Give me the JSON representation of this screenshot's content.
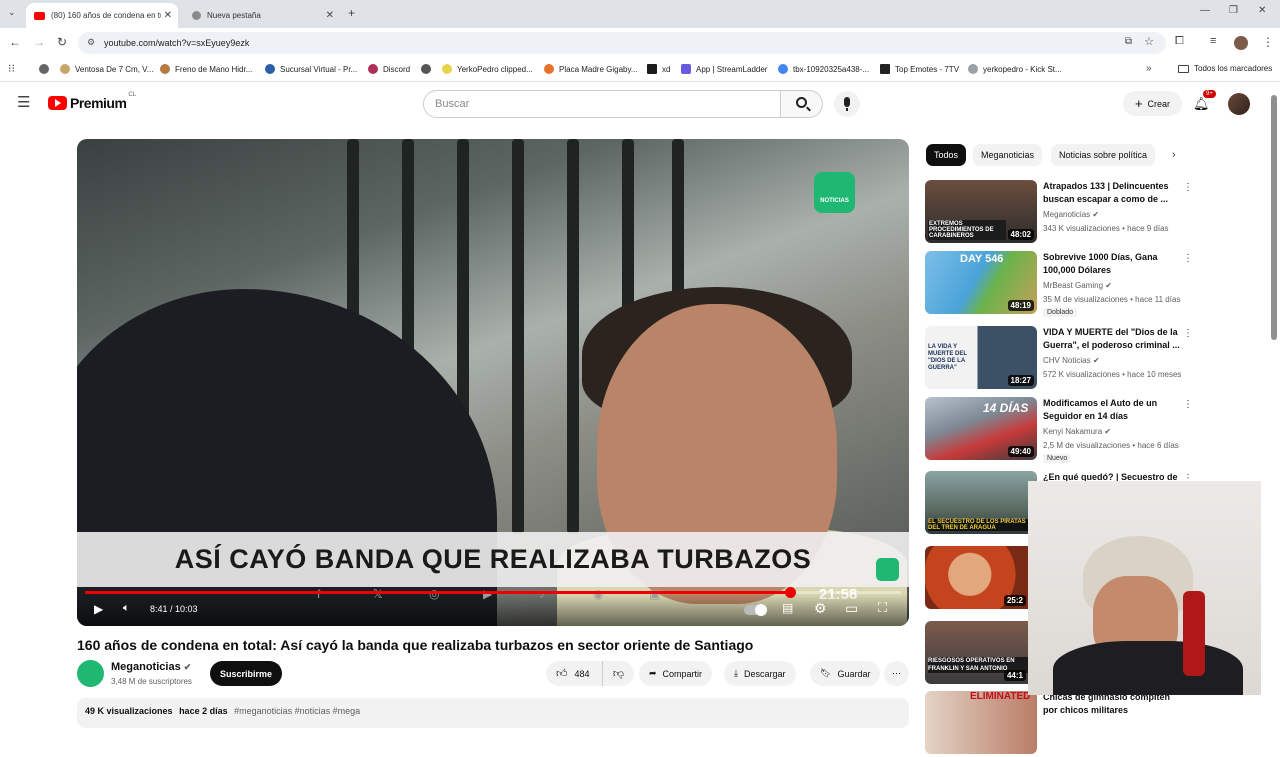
{
  "browser": {
    "tabs": [
      {
        "label": "(80) 160 años de condena en tu",
        "active": true
      },
      {
        "label": "Nueva pestaña",
        "active": false
      }
    ],
    "new_tab": "+",
    "url": "youtube.com/watch?v=sxEyuey9ezk",
    "bookmarks": [
      "Ventosa De 7 Cm, V...",
      "Freno de Mano Hidr...",
      "Sucursal Virtual - Pr...",
      "Discord",
      "YerkoPedro clipped...",
      "Placa Madre Gigaby...",
      "xd",
      "App | StreamLadder",
      "tbx-10920325a438-...",
      "Top Emotes - 7TV",
      "yerkopedro - Kick St..."
    ],
    "all_bookmarks": "Todos los marcadores"
  },
  "youtube": {
    "logo_text": "Premium",
    "region": "CL",
    "search_placeholder": "Buscar",
    "create_label": "Crear",
    "notifications": "9+"
  },
  "player": {
    "banner_text": "ASÍ CAYÓ BANDA QUE REALIZABA TURBAZOS",
    "logo_label": "NOTICIAS",
    "time_current": "8:41",
    "time_total": "10:03",
    "time_display": "8:41 / 10:03",
    "overlay_time": "21:58",
    "progress": 0.864
  },
  "video": {
    "title": "160 años de condena en total: Así cayó la banda que realizaba turbazos en sector oriente de Santiago",
    "channel": "Meganoticias",
    "subscribers": "3,48 M de suscriptores",
    "subscribe_label": "Suscribirme",
    "likes": "484",
    "share_label": "Compartir",
    "download_label": "Descargar",
    "save_label": "Guardar",
    "views": "49 K visualizaciones",
    "date": "hace 2 días",
    "tags": "#meganoticias #noticias #mega"
  },
  "chips": [
    "Todos",
    "Meganoticias",
    "Noticias sobre política"
  ],
  "related": [
    {
      "title": "Atrapados 133 | Delincuentes buscan escapar a como de ...",
      "channel": "Meganoticias",
      "meta": "343 K visualizaciones • hace 9 días",
      "duration": "48:02",
      "thumb_text": "EXTREMOS PROCEDIMIENTOS DE CARABINEROS",
      "badge": ""
    },
    {
      "title": "Sobrevive 1000 Días, Gana 100,000 Dólares",
      "channel": "MrBeast Gaming",
      "meta": "35 M de visualizaciones • hace 11 días",
      "duration": "48:19",
      "thumb_text": "DAY 546",
      "badge": "Doblado"
    },
    {
      "title": "VIDA Y MUERTE del \"Dios de la Guerra\", el poderoso criminal ...",
      "channel": "CHV Noticias",
      "meta": "572 K visualizaciones • hace 10 meses",
      "duration": "18:27",
      "thumb_text": "LA VIDA Y MUERTE DEL \"DIOS DE LA GUERRA\"",
      "badge": ""
    },
    {
      "title": "Modificamos el Auto de un Seguidor en 14 días",
      "channel": "Kenyi Nakamura",
      "meta": "2,5 M de visualizaciones • hace 6 días",
      "duration": "49:40",
      "thumb_text": "14 DÍAS",
      "badge": "Nuevo"
    },
    {
      "title": "¿En qué quedó? | Secuestro de",
      "channel": "",
      "meta": "",
      "duration": "",
      "thumb_text": "EL SECUESTRO DE LOS PIRATAS DEL TREN DE ARAGUA",
      "badge": ""
    },
    {
      "title": "",
      "channel": "",
      "meta": "",
      "duration": "25:2",
      "thumb_text": "",
      "badge": ""
    },
    {
      "title": "",
      "channel": "",
      "meta": "",
      "duration": "44:1",
      "thumb_text": "RIESGOSOS OPERATIVOS EN FRANKLIN Y SAN ANTONIO",
      "badge": ""
    },
    {
      "title": "Chicas de gimnasio compiten por chicos militares",
      "channel": "",
      "meta": "",
      "duration": "",
      "thumb_text": "ELIMINATED",
      "badge": ""
    }
  ]
}
